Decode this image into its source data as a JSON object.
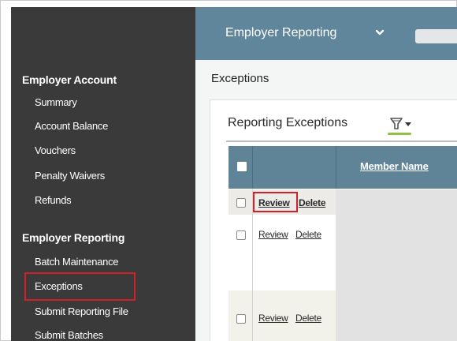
{
  "sidebar": {
    "sections": [
      {
        "heading": "Employer Account",
        "items": [
          "Summary",
          "Account Balance",
          "Vouchers",
          "Penalty Waivers",
          "Refunds"
        ]
      },
      {
        "heading": "Employer Reporting",
        "items": [
          "Batch Maintenance",
          "Exceptions",
          "Submit Reporting File",
          "Submit Batches"
        ]
      }
    ],
    "selected_item": "Exceptions"
  },
  "topbar": {
    "title": "Employer Reporting",
    "chevron_icon": "chevron-down-icon"
  },
  "page": {
    "title": "Exceptions"
  },
  "panel": {
    "title": "Reporting Exceptions",
    "filter_icon": "filter-dropdown-icon"
  },
  "table": {
    "columns": [
      "",
      "",
      "Member Name"
    ],
    "rows": [
      {
        "review": "Review",
        "delete": "Delete",
        "highlighted": true
      },
      {
        "review": "Review",
        "delete": "Delete",
        "highlighted": false
      },
      {
        "review": "Review",
        "delete": "Delete",
        "highlighted": false
      }
    ]
  },
  "colors": {
    "sidebar_bg": "#3a3a3a",
    "topbar_bg": "#60869b",
    "table_header_bg": "#5f8497",
    "highlight_box": "#d0202a",
    "filter_accent": "#8fc23f"
  }
}
